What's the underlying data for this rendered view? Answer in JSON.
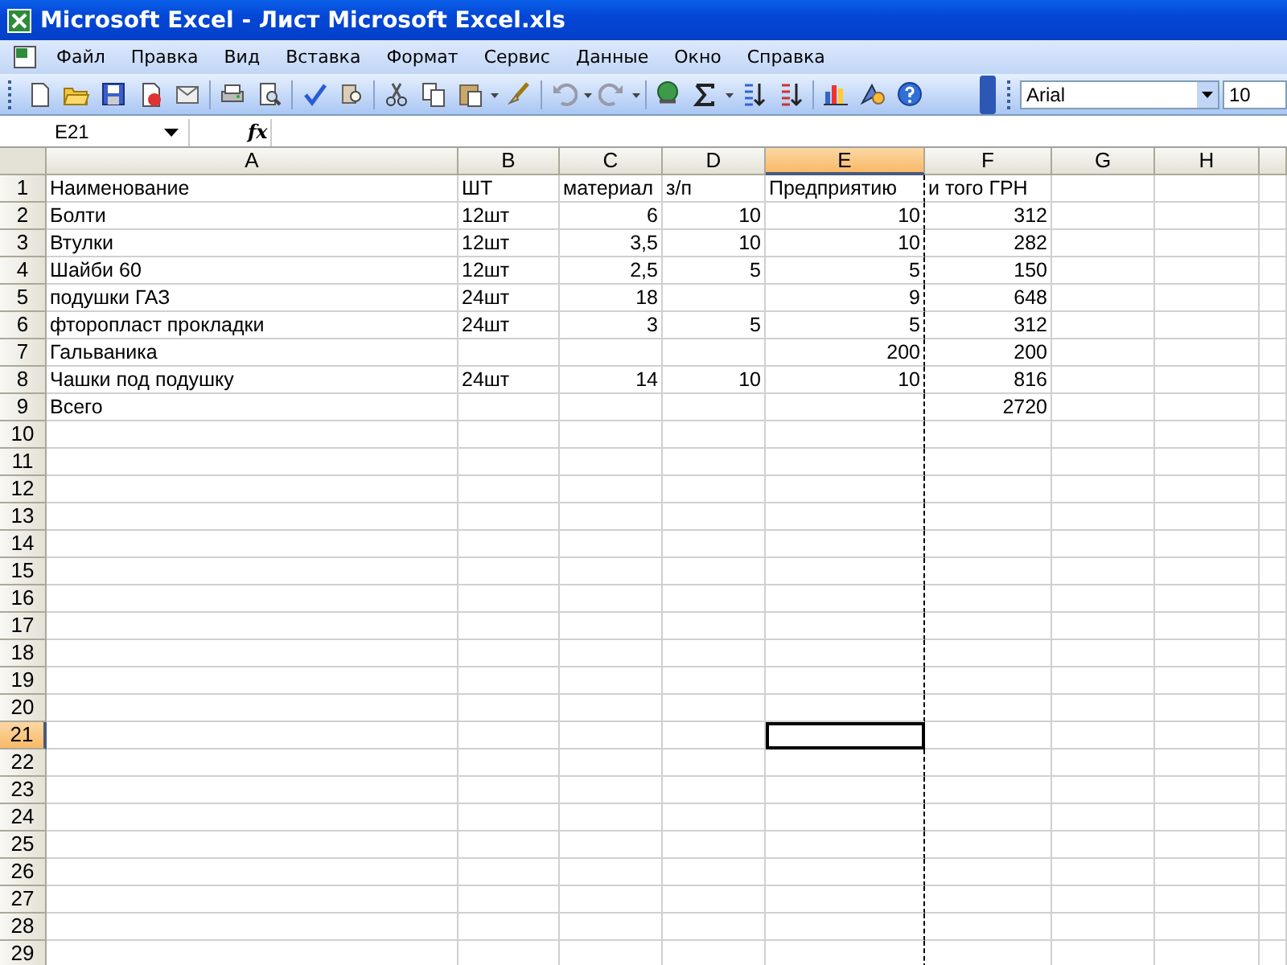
{
  "window": {
    "title": "Microsoft Excel - Лист Microsoft Excel.xls"
  },
  "menu": [
    "Файл",
    "Правка",
    "Вид",
    "Вставка",
    "Формат",
    "Сервис",
    "Данные",
    "Окно",
    "Справка"
  ],
  "font_box": {
    "font": "Arial",
    "size": "10"
  },
  "formula_bar": {
    "name_box": "E21",
    "fx_label": "fx"
  },
  "columns": [
    {
      "label": "A",
      "selected": false
    },
    {
      "label": "B",
      "selected": false
    },
    {
      "label": "C",
      "selected": false
    },
    {
      "label": "D",
      "selected": false
    },
    {
      "label": "E",
      "selected": true
    },
    {
      "label": "F",
      "selected": false
    },
    {
      "label": "G",
      "selected": false
    },
    {
      "label": "H",
      "selected": false
    }
  ],
  "rows": [
    {
      "label": "1",
      "selected": false,
      "cells": [
        {
          "text": "Наименование",
          "kind": "text"
        },
        {
          "text": "ШТ",
          "kind": "text"
        },
        {
          "text": "материал",
          "kind": "text"
        },
        {
          "text": "з/п",
          "kind": "text"
        },
        {
          "text": "Предприятию",
          "kind": "text"
        },
        {
          "text": "и того ГРН",
          "kind": "text"
        },
        null,
        null
      ]
    },
    {
      "label": "2",
      "selected": false,
      "cells": [
        {
          "text": "Болти",
          "kind": "text"
        },
        {
          "text": "12шт",
          "kind": "text"
        },
        {
          "text": "6",
          "kind": "number"
        },
        {
          "text": "10",
          "kind": "number"
        },
        {
          "text": "10",
          "kind": "number"
        },
        {
          "text": "312",
          "kind": "number"
        },
        null,
        null
      ]
    },
    {
      "label": "3",
      "selected": false,
      "cells": [
        {
          "text": "Втулки",
          "kind": "text"
        },
        {
          "text": "12шт",
          "kind": "text"
        },
        {
          "text": "3,5",
          "kind": "number"
        },
        {
          "text": "10",
          "kind": "number"
        },
        {
          "text": "10",
          "kind": "number"
        },
        {
          "text": "282",
          "kind": "number"
        },
        null,
        null
      ]
    },
    {
      "label": "4",
      "selected": false,
      "cells": [
        {
          "text": "Шайби 60",
          "kind": "text"
        },
        {
          "text": "12шт",
          "kind": "text"
        },
        {
          "text": "2,5",
          "kind": "number"
        },
        {
          "text": "5",
          "kind": "number"
        },
        {
          "text": "5",
          "kind": "number"
        },
        {
          "text": "150",
          "kind": "number"
        },
        null,
        null
      ]
    },
    {
      "label": "5",
      "selected": false,
      "cells": [
        {
          "text": "подушки ГАЗ",
          "kind": "text"
        },
        {
          "text": "24шт",
          "kind": "text"
        },
        {
          "text": "18",
          "kind": "number"
        },
        null,
        {
          "text": "9",
          "kind": "number"
        },
        {
          "text": "648",
          "kind": "number"
        },
        null,
        null
      ]
    },
    {
      "label": "6",
      "selected": false,
      "cells": [
        {
          "text": "фторопласт прокладки",
          "kind": "text"
        },
        {
          "text": "24шт",
          "kind": "text"
        },
        {
          "text": "3",
          "kind": "number"
        },
        {
          "text": "5",
          "kind": "number"
        },
        {
          "text": "5",
          "kind": "number"
        },
        {
          "text": "312",
          "kind": "number"
        },
        null,
        null
      ]
    },
    {
      "label": "7",
      "selected": false,
      "cells": [
        {
          "text": "Гальваника",
          "kind": "text"
        },
        null,
        null,
        null,
        {
          "text": "200",
          "kind": "number"
        },
        {
          "text": "200",
          "kind": "number"
        },
        null,
        null
      ]
    },
    {
      "label": "8",
      "selected": false,
      "cells": [
        {
          "text": "Чашки под подушку",
          "kind": "text"
        },
        {
          "text": "24шт",
          "kind": "text"
        },
        {
          "text": "14",
          "kind": "number"
        },
        {
          "text": "10",
          "kind": "number"
        },
        {
          "text": "10",
          "kind": "number"
        },
        {
          "text": "816",
          "kind": "number"
        },
        null,
        null
      ]
    },
    {
      "label": "9",
      "selected": false,
      "cells": [
        {
          "text": "Всего",
          "kind": "text"
        },
        null,
        null,
        null,
        null,
        {
          "text": "2720",
          "kind": "number"
        },
        null,
        null
      ]
    },
    {
      "label": "10",
      "selected": false
    },
    {
      "label": "11",
      "selected": false
    },
    {
      "label": "12",
      "selected": false
    },
    {
      "label": "13",
      "selected": false
    },
    {
      "label": "14",
      "selected": false
    },
    {
      "label": "15",
      "selected": false
    },
    {
      "label": "16",
      "selected": false
    },
    {
      "label": "17",
      "selected": false
    },
    {
      "label": "18",
      "selected": false
    },
    {
      "label": "19",
      "selected": false
    },
    {
      "label": "20",
      "selected": false
    },
    {
      "label": "21",
      "selected": true
    },
    {
      "label": "22",
      "selected": false
    },
    {
      "label": "23",
      "selected": false
    },
    {
      "label": "24",
      "selected": false
    },
    {
      "label": "25",
      "selected": false
    },
    {
      "label": "26",
      "selected": false
    },
    {
      "label": "27",
      "selected": false
    },
    {
      "label": "28",
      "selected": false
    },
    {
      "label": "29",
      "selected": false
    }
  ]
}
